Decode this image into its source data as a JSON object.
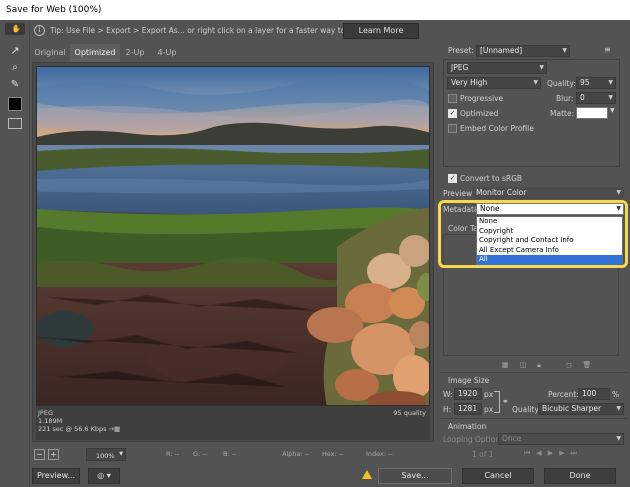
{
  "window": {
    "title": "Save for Web (100%)"
  },
  "tip": {
    "text": "Tip: Use File > Export > Export As...  or right click on a layer for a faster way to export assets",
    "learn_more": "Learn More"
  },
  "tools": [
    {
      "name": "hand-tool-icon",
      "glyph": "✋"
    },
    {
      "name": "slice-select-tool-icon",
      "glyph": "↗"
    },
    {
      "name": "zoom-tool-icon",
      "glyph": "🔍"
    },
    {
      "name": "eyedropper-tool-icon",
      "glyph": "✎"
    }
  ],
  "tabs": {
    "original": "Original",
    "optimized": "Optimized",
    "two_up": "2-Up",
    "four_up": "4-Up"
  },
  "image_info": {
    "format": "JPEG",
    "size": "1.189M",
    "time": "221 sec @ 56.6 Kbps",
    "time_suffix": "→▦",
    "quality": "95 quality"
  },
  "bottom": {
    "zoom": "100%",
    "r": "R: --",
    "g": "G: --",
    "b": "B: --",
    "alpha": "Alpha: --",
    "hex": "Hex: --",
    "index": "Index: --"
  },
  "settings": {
    "preset_label": "Preset:",
    "preset_value": "[Unnamed]",
    "format_value": "JPEG",
    "quality_level": "Very High",
    "quality_label": "Quality:",
    "quality_value": "95",
    "progressive_label": "Progressive",
    "blur_label": "Blur:",
    "blur_value": "0",
    "optimized_label": "Optimized",
    "matte_label": "Matte:",
    "embed_profile_label": "Embed Color Profile",
    "convert_srgb_label": "Convert to sRGB",
    "preview_label": "Preview:",
    "preview_value": "Monitor Color",
    "metadata_label": "Metadata:",
    "metadata_value": "None",
    "color_table_label": "Color Tab",
    "metadata_options": [
      "None",
      "Copyright",
      "Copyright and Contact Info",
      "All Except Camera Info",
      "All"
    ]
  },
  "image_size": {
    "title": "Image Size",
    "w_label": "W:",
    "w_value": "1920",
    "h_label": "H:",
    "h_value": "1281",
    "unit": "px",
    "percent_label": "Percent:",
    "percent_value": "100",
    "percent_unit": "%",
    "quality_label": "Quality:",
    "quality_value": "Bicubic Sharper"
  },
  "animation": {
    "title": "Animation",
    "looping_label": "Looping Options:",
    "looping_value": "Once",
    "frame_counter": "1 of 1"
  },
  "buttons": {
    "preview": "Preview...",
    "save": "Save...",
    "cancel": "Cancel",
    "done": "Done"
  },
  "colors": {
    "highlight": "#f7d94d",
    "selected_option": "#3072d6",
    "warning": "#f0c419"
  }
}
